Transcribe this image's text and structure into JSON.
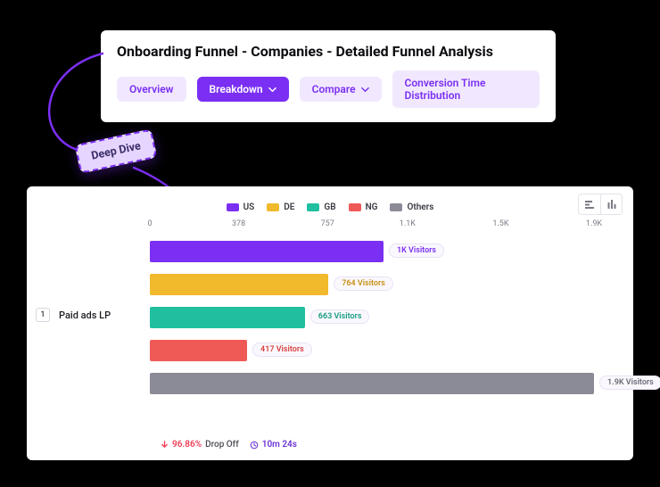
{
  "header": {
    "title": "Onboarding Funnel - Companies - Detailed Funnel Analysis",
    "tabs": {
      "overview": "Overview",
      "breakdown": "Breakdown",
      "compare": "Compare",
      "conv_dist": "Conversion Time Distribution"
    }
  },
  "callout": {
    "label": "Deep Dive"
  },
  "colors": {
    "US": "#7b2ff2",
    "DE": "#f1b92c",
    "GB": "#1fbf9f",
    "NG": "#ef5a57",
    "Others": "#8b8b97",
    "purple_light": "#f1e8ff",
    "purple_text": "#6a34d6"
  },
  "chart": {
    "step_index": "1",
    "step_label": "Paid ads LP",
    "axis_ticks": [
      "0",
      "378",
      "757",
      "1.1K",
      "1.5K",
      "1.9K"
    ],
    "legend": [
      "US",
      "DE",
      "GB",
      "NG",
      "Others"
    ],
    "bars": [
      {
        "label": "1K Visitors",
        "color_key": "US",
        "label_color": "#7b2ff2"
      },
      {
        "label": "764 Visitors",
        "color_key": "DE",
        "label_color": "#c88f12"
      },
      {
        "label": "663 Visitors",
        "color_key": "GB",
        "label_color": "#159a80"
      },
      {
        "label": "417 Visitors",
        "color_key": "NG",
        "label_color": "#d93f3c"
      },
      {
        "label": "1.9K Visitors",
        "color_key": "Others",
        "label_color": "#6b6b76"
      }
    ],
    "footer": {
      "drop_pct": "96.86%",
      "drop_text": "Drop Off",
      "time": "10m 24s"
    }
  },
  "chart_data": {
    "type": "bar",
    "orientation": "horizontal",
    "title": "",
    "categories": [
      "US",
      "DE",
      "GB",
      "NG",
      "Others"
    ],
    "values": [
      1000,
      764,
      663,
      417,
      1900
    ],
    "xlabel": "Visitors",
    "ylabel": "",
    "xlim": [
      0,
      1900
    ],
    "x_ticks": [
      0,
      378,
      757,
      1100,
      1500,
      1900
    ],
    "step": {
      "index": 1,
      "name": "Paid ads LP"
    },
    "drop_off_pct": 96.86,
    "avg_time_seconds": 624
  }
}
